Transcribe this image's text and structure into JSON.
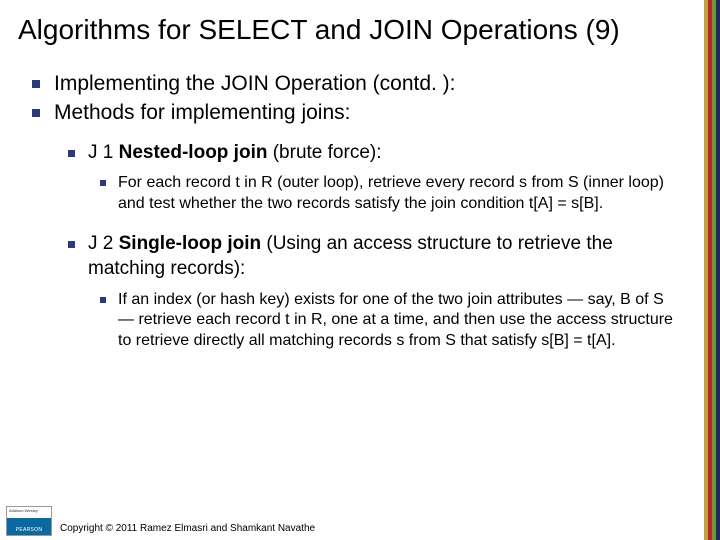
{
  "title": "Algorithms for SELECT and JOIN Operations (9)",
  "bullets": {
    "b1": "Implementing the JOIN Operation (contd. ):",
    "b2": "Methods for implementing joins:",
    "j1": {
      "label": "J 1 ",
      "title": "Nested-loop join",
      "paren": " (brute force):",
      "detail": "For each record t in R (outer loop), retrieve every record s from S (inner loop) and test whether the two records satisfy the join condition t[A] = s[B]."
    },
    "j2": {
      "label": "J 2 ",
      "title": "Single-loop join",
      "paren": " (Using an access structure to retrieve the matching records):",
      "detail": "If an index (or hash key) exists for one of the two join attributes — say, B of S — retrieve each record t in R, one at a time, and then use the access structure to retrieve directly all matching records s from S that satisfy s[B] = t[A]."
    }
  },
  "footer": "Copyright © 2011 Ramez Elmasri and Shamkant Navathe"
}
